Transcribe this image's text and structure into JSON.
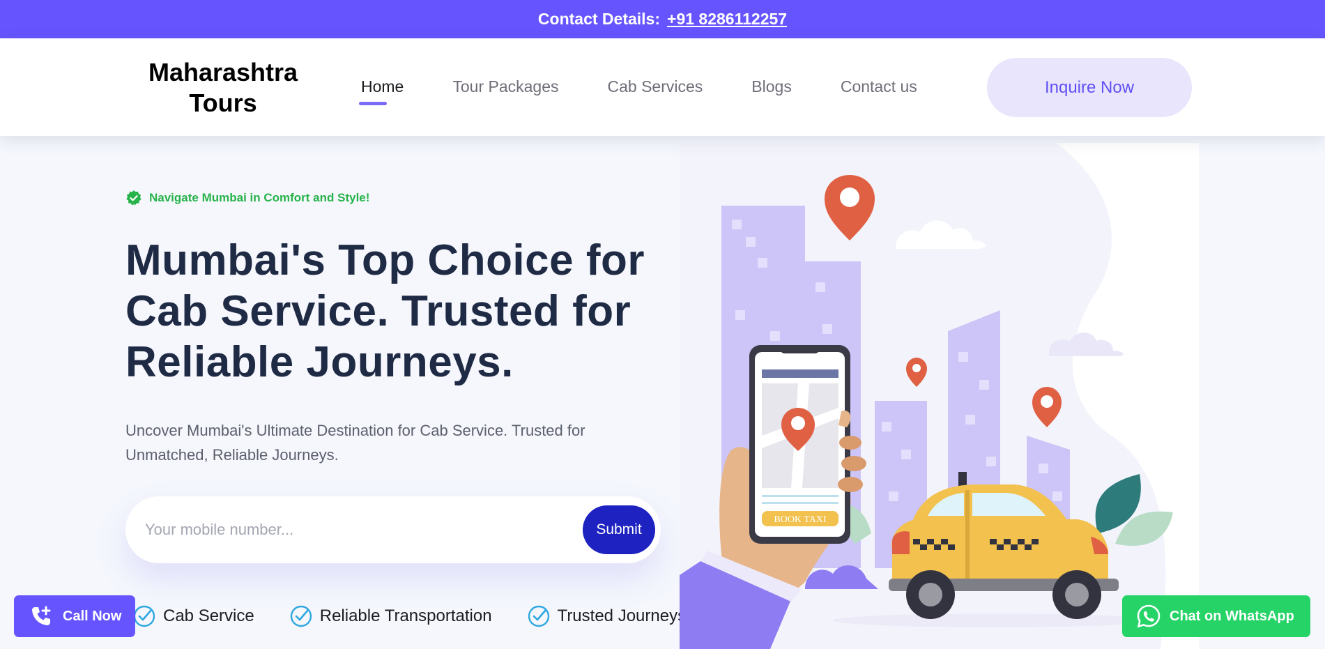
{
  "topbar": {
    "label": "Contact Details:",
    "phone": "+91 8286112257"
  },
  "header": {
    "logo_line1": "Maharashtra",
    "logo_line2": "Tours",
    "nav": [
      {
        "label": "Home",
        "active": true
      },
      {
        "label": "Tour Packages"
      },
      {
        "label": "Cab Services"
      },
      {
        "label": "Blogs"
      },
      {
        "label": "Contact us"
      }
    ],
    "inquire_label": "Inquire Now"
  },
  "hero": {
    "badge": "Navigate Mumbai in Comfort and Style!",
    "headline_line1": "Mumbai's Top Choice for",
    "headline_line2": "Cab Service. Trusted for",
    "headline_line3": "Reliable Journeys.",
    "subtext_line1": "Uncover Mumbai's Ultimate Destination for Cab Service. Trusted for",
    "subtext_line2": "Unmatched, Reliable Journeys.",
    "form": {
      "placeholder": "Your mobile number...",
      "submit_label": "Submit"
    },
    "features": [
      "Cab Service",
      "Reliable Transportation",
      "Trusted Journeys"
    ],
    "phone_screen_button": "BOOK TAXI"
  },
  "floating": {
    "call_label": "Call Now",
    "whatsapp_label": "Chat on WhatsApp"
  },
  "colors": {
    "brand": "#6655ff",
    "submit": "#1e22c0",
    "badge_green": "#27b34a",
    "whatsapp": "#25d366",
    "taxi": "#f2c14e",
    "pin": "#e06043"
  }
}
